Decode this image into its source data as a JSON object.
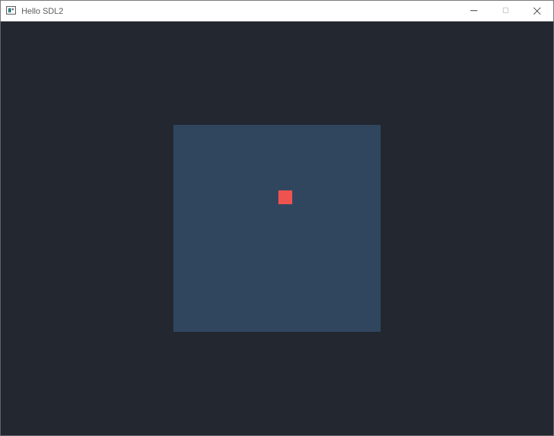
{
  "window": {
    "title": "Hello SDL2",
    "icon": "app-window-icon",
    "controls": [
      "minimize-icon",
      "maximize-icon",
      "close-icon"
    ]
  },
  "scene": {
    "background_color": "#222730",
    "square_color": "#30465e",
    "marker_color": "#ef5350"
  }
}
